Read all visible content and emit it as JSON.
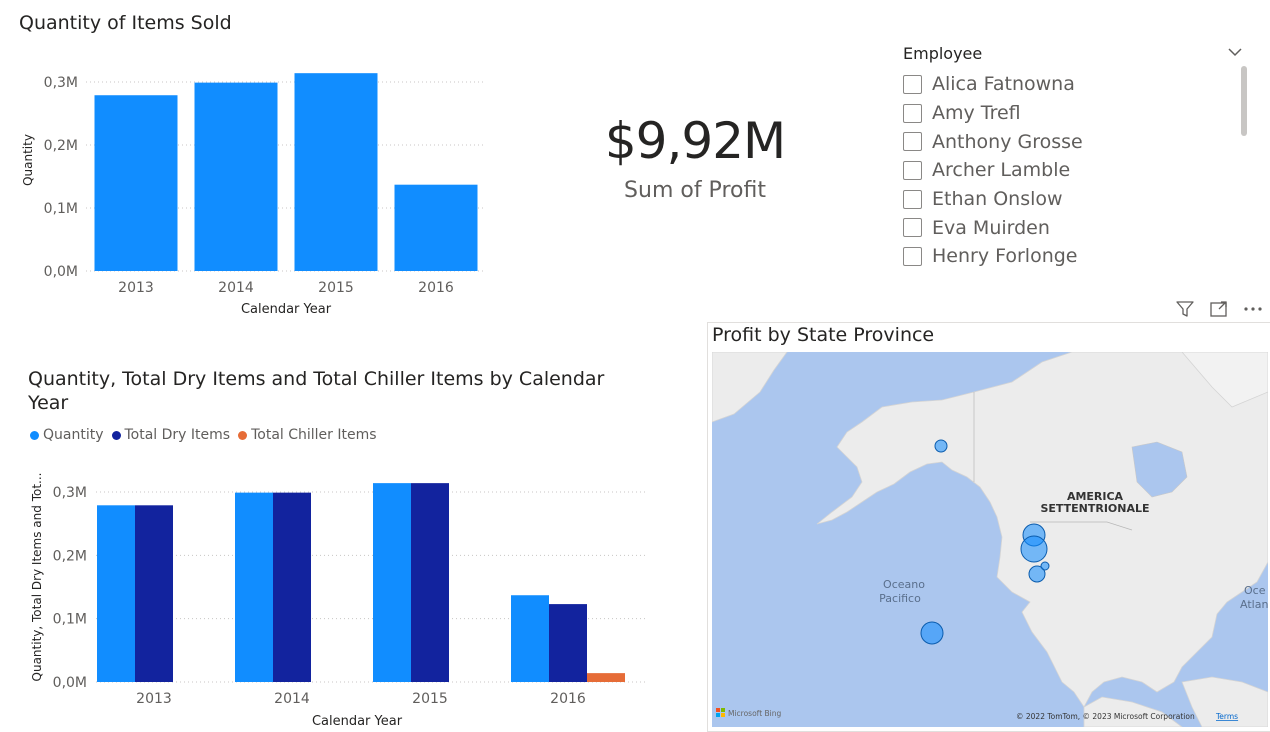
{
  "chart1": {
    "chart_data": {
      "type": "bar",
      "title": "Quantity of Items Sold",
      "xlabel": "Calendar Year",
      "ylabel": "Quantity",
      "categories": [
        "2013",
        "2014",
        "2015",
        "2016"
      ],
      "values": [
        279000,
        299000,
        314000,
        137000
      ],
      "ylim": [
        0,
        300000
      ],
      "yticks": [
        "0,0M",
        "0,1M",
        "0,2M",
        "0,3M"
      ],
      "ytick_values": [
        0,
        100000,
        200000,
        300000
      ],
      "grid": true,
      "color": "#118dff"
    }
  },
  "card": {
    "value": "$9,92M",
    "label": "Sum of Profit"
  },
  "slicer": {
    "header": "Employee",
    "items": [
      "Alica Fatnowna",
      "Amy Trefl",
      "Anthony Grosse",
      "Archer Lamble",
      "Ethan Onslow",
      "Eva Muirden",
      "Henry Forlonge"
    ]
  },
  "chart2": {
    "chart_data": {
      "type": "bar",
      "title": "Quantity, Total Dry Items and Total Chiller Items by Calendar Year",
      "xlabel": "Calendar Year",
      "ylabel": "Quantity, Total Dry Items and Tot...",
      "categories": [
        "2013",
        "2014",
        "2015",
        "2016"
      ],
      "series": [
        {
          "name": "Quantity",
          "values": [
            279000,
            299000,
            314000,
            137000
          ],
          "color": "#118dff"
        },
        {
          "name": "Total Dry Items",
          "values": [
            279000,
            299000,
            314000,
            123000
          ],
          "color": "#12239e"
        },
        {
          "name": "Total Chiller Items",
          "values": [
            0,
            0,
            0,
            14000
          ],
          "color": "#e66c37"
        }
      ],
      "ylim": [
        0,
        300000
      ],
      "yticks": [
        "0,0M",
        "0,1M",
        "0,2M",
        "0,3M"
      ],
      "ytick_values": [
        0,
        100000,
        200000,
        300000
      ],
      "legend_position": "top-left",
      "grid": true
    }
  },
  "map": {
    "title": "Profit by State Province",
    "labels": {
      "continent_line1": "AMERICA",
      "continent_line2": "SETTENTRIONALE",
      "ocean_line1": "Oceano",
      "ocean_line2": "Pacifico",
      "right_line1": "Oce",
      "right_line2": "Atlan"
    },
    "attribution": "© 2022 TomTom, © 2023 Microsoft Corporation",
    "terms": "Terms",
    "bing": "Microsoft Bing",
    "icons": [
      "filter-icon",
      "focus-mode-icon",
      "more-options-icon"
    ],
    "colors": {
      "water": "#abc6ee",
      "land": "#ececec",
      "bubble": "#118dff"
    }
  }
}
